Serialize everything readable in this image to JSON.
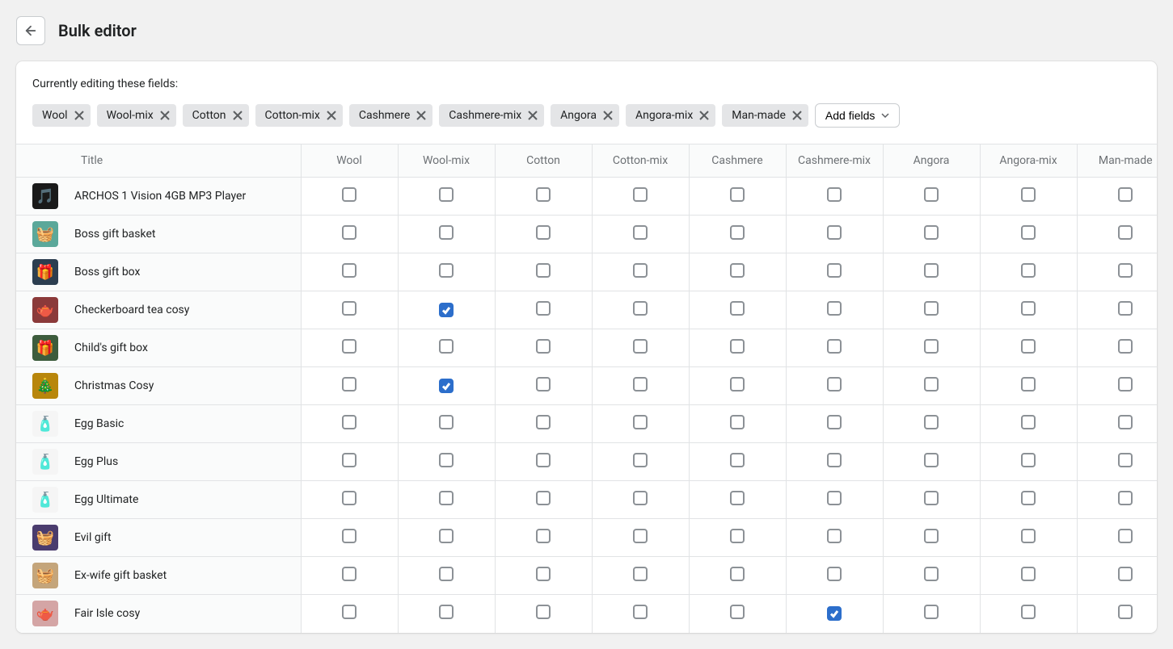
{
  "header": {
    "title": "Bulk editor"
  },
  "editing_label": "Currently editing these fields:",
  "fields": [
    "Wool",
    "Wool-mix",
    "Cotton",
    "Cotton-mix",
    "Cashmere",
    "Cashmere-mix",
    "Angora",
    "Angora-mix",
    "Man-made"
  ],
  "add_fields_label": "Add fields",
  "columns": {
    "title": "Title"
  },
  "products": [
    {
      "title": "ARCHOS 1 Vision 4GB MP3 Player",
      "thumb_bg": "#1a1a1a",
      "thumb_emoji": "🎵",
      "checked": [
        false,
        false,
        false,
        false,
        false,
        false,
        false,
        false,
        false
      ]
    },
    {
      "title": "Boss gift basket",
      "thumb_bg": "#5ba89a",
      "thumb_emoji": "🧺",
      "checked": [
        false,
        false,
        false,
        false,
        false,
        false,
        false,
        false,
        false
      ]
    },
    {
      "title": "Boss gift box",
      "thumb_bg": "#2c3e50",
      "thumb_emoji": "🎁",
      "checked": [
        false,
        false,
        false,
        false,
        false,
        false,
        false,
        false,
        false
      ]
    },
    {
      "title": "Checkerboard tea cosy",
      "thumb_bg": "#8b3a3a",
      "thumb_emoji": "🫖",
      "checked": [
        false,
        true,
        false,
        false,
        false,
        false,
        false,
        false,
        false
      ]
    },
    {
      "title": "Child's gift box",
      "thumb_bg": "#3d5c3d",
      "thumb_emoji": "🎁",
      "checked": [
        false,
        false,
        false,
        false,
        false,
        false,
        false,
        false,
        false
      ]
    },
    {
      "title": "Christmas Cosy",
      "thumb_bg": "#b8860b",
      "thumb_emoji": "🎄",
      "checked": [
        false,
        true,
        false,
        false,
        false,
        false,
        false,
        false,
        false
      ]
    },
    {
      "title": "Egg Basic",
      "thumb_bg": "#f5f5f5",
      "thumb_emoji": "🧴",
      "checked": [
        false,
        false,
        false,
        false,
        false,
        false,
        false,
        false,
        false
      ]
    },
    {
      "title": "Egg Plus",
      "thumb_bg": "#f5f5f5",
      "thumb_emoji": "🧴",
      "checked": [
        false,
        false,
        false,
        false,
        false,
        false,
        false,
        false,
        false
      ]
    },
    {
      "title": "Egg Ultimate",
      "thumb_bg": "#f5f5f5",
      "thumb_emoji": "🧴",
      "checked": [
        false,
        false,
        false,
        false,
        false,
        false,
        false,
        false,
        false
      ]
    },
    {
      "title": "Evil gift",
      "thumb_bg": "#4a3c6e",
      "thumb_emoji": "🧺",
      "checked": [
        false,
        false,
        false,
        false,
        false,
        false,
        false,
        false,
        false
      ]
    },
    {
      "title": "Ex-wife gift basket",
      "thumb_bg": "#c4a57b",
      "thumb_emoji": "🧺",
      "checked": [
        false,
        false,
        false,
        false,
        false,
        false,
        false,
        false,
        false
      ]
    },
    {
      "title": "Fair Isle cosy",
      "thumb_bg": "#d4a5a5",
      "thumb_emoji": "🫖",
      "checked": [
        false,
        false,
        false,
        false,
        false,
        true,
        false,
        false,
        false
      ]
    }
  ]
}
